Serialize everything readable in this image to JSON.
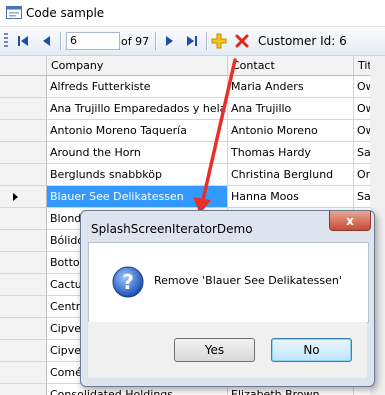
{
  "window": {
    "title": "Code sample"
  },
  "toolbar": {
    "position": "6",
    "of_label": "of 97",
    "customer_label": "Customer Id: 6"
  },
  "grid": {
    "columns": [
      "Company",
      "Contact",
      "Title"
    ],
    "rows": [
      [
        "Alfreds Futterkiste",
        "Maria Anders",
        "Owne"
      ],
      [
        "Ana Trujillo Emparedados y helados",
        "Ana Trujillo",
        "Owne"
      ],
      [
        "Antonio Moreno Taquería",
        "Antonio Moreno",
        "Owne"
      ],
      [
        "Around the Horn",
        "Thomas Hardy",
        "Sales"
      ],
      [
        "Berglunds snabbköp",
        "Christina Berglund",
        "Order"
      ],
      [
        "Blauer See Delikatessen",
        "Hanna Moos",
        "Sales"
      ],
      [
        "Blonde",
        "",
        ""
      ],
      [
        "Bólido",
        "",
        ""
      ],
      [
        "Bottom",
        "",
        ""
      ],
      [
        "Cactus",
        "",
        ""
      ],
      [
        "Centro",
        "",
        ""
      ],
      [
        "Cipver",
        "",
        ""
      ],
      [
        "Cipver",
        "",
        ""
      ],
      [
        "Comér",
        "",
        ""
      ],
      [
        "Consolidated Holdings",
        "Elizabeth Brown",
        ""
      ]
    ],
    "selected_row": 5
  },
  "dialog": {
    "title": "SplashScreenIteratorDemo",
    "message": "Remove 'Blauer See Delikatessen'",
    "yes_label": "Yes",
    "no_label": "No",
    "close_label": "x"
  },
  "colors": {
    "selection": "#3399ff",
    "arrow": "#e8302a",
    "dialog_frame": "#dde4ee"
  }
}
